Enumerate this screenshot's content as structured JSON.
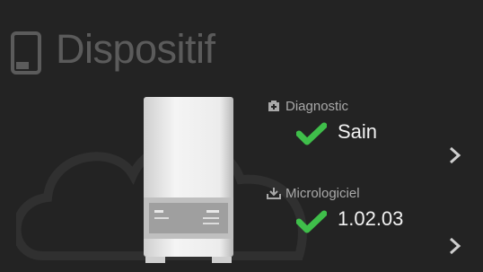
{
  "header": {
    "title": "Dispositif",
    "icon": "device-icon"
  },
  "diagnostic": {
    "label": "Diagnostic",
    "icon": "health-icon",
    "status": "Sain",
    "status_icon": "checkmark-icon"
  },
  "firmware": {
    "label": "Micrologiciel",
    "icon": "download-icon",
    "version": "1.02.03",
    "status_icon": "checkmark-icon"
  },
  "colors": {
    "background": "#232323",
    "title_text": "#5b5b5b",
    "label_text": "#a9a9a9",
    "value_text": "#f2f2f2",
    "check_green": "#3fbe4a"
  }
}
